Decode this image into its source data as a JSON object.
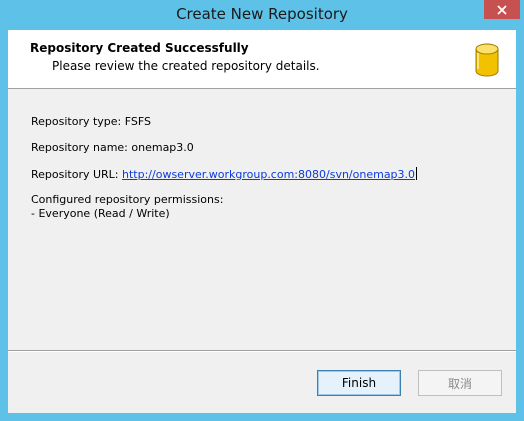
{
  "window": {
    "title": "Create New Repository"
  },
  "header": {
    "title": "Repository Created Successfully",
    "subtitle": "Please review the created repository details."
  },
  "details": {
    "type_line": "Repository type: FSFS",
    "name_line": "Repository name: onemap3.0",
    "url_label": "Repository URL: ",
    "url_value": "http://owserver.workgroup.com:8080/svn/onemap3.0",
    "permissions_heading": "Configured repository permissions:",
    "permissions_item": "- Everyone (Read / Write)"
  },
  "buttons": {
    "finish_label": "Finish",
    "cancel_label": "取消"
  },
  "icons": {
    "close": "close-icon",
    "repository": "database-icon"
  },
  "colors": {
    "titlebar": "#5ec2e8",
    "close_button": "#c75050",
    "link": "#0b3bd8",
    "icon_fill": "#f5c400"
  }
}
